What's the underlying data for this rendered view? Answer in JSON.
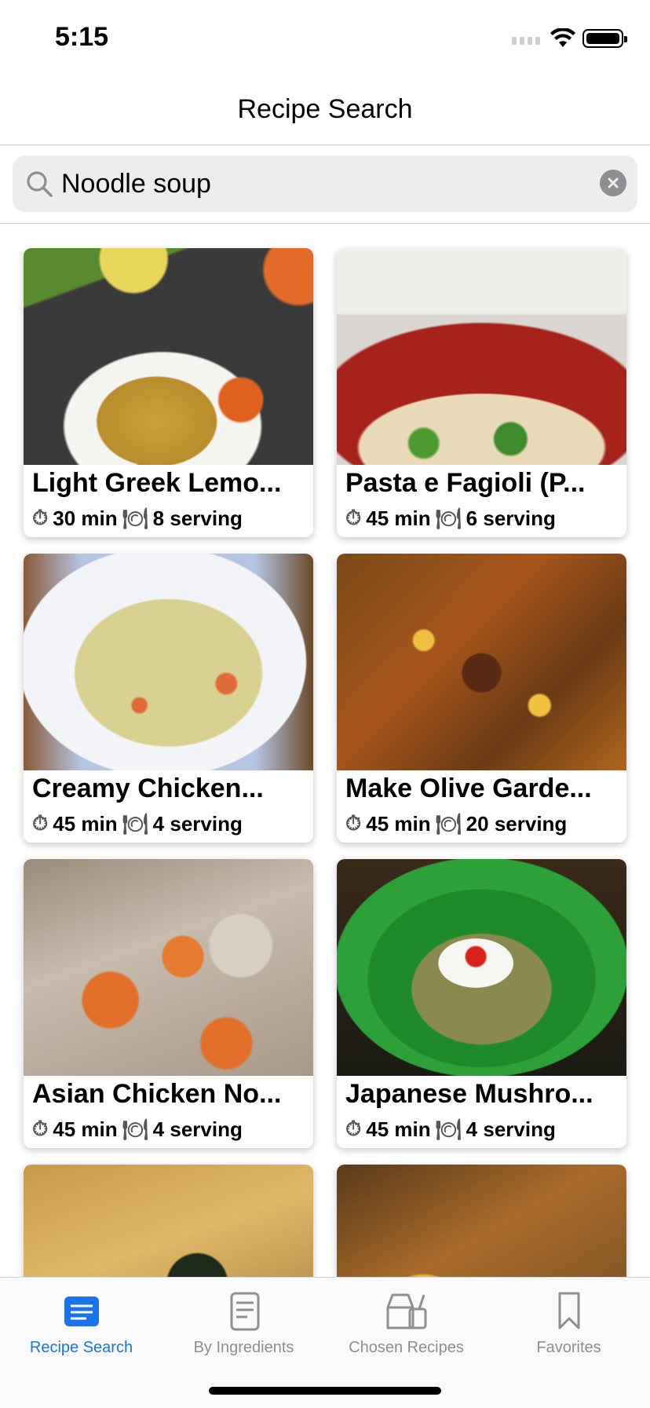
{
  "status": {
    "time": "5:15"
  },
  "nav": {
    "title": "Recipe Search"
  },
  "search": {
    "value": "Noodle soup",
    "placeholder": "Search"
  },
  "recipes": [
    {
      "title": "Light Greek Lemo...",
      "time": "30 min",
      "servings": "8 serving"
    },
    {
      "title": "Pasta e Fagioli (P...",
      "time": "45 min",
      "servings": "6 serving"
    },
    {
      "title": "Creamy Chicken...",
      "time": "45 min",
      "servings": "4 serving"
    },
    {
      "title": "Make Olive Garde...",
      "time": "45 min",
      "servings": "20 serving"
    },
    {
      "title": "Asian Chicken No...",
      "time": "45 min",
      "servings": "4 serving"
    },
    {
      "title": "Japanese Mushro...",
      "time": "45 min",
      "servings": "4 serving"
    },
    {
      "title": "",
      "time": "",
      "servings": ""
    },
    {
      "title": "",
      "time": "",
      "servings": ""
    }
  ],
  "tabs": [
    {
      "label": "Recipe Search",
      "icon": "recipe-search-icon",
      "active": true
    },
    {
      "label": "By Ingredients",
      "icon": "ingredients-list-icon",
      "active": false
    },
    {
      "label": "Chosen Recipes",
      "icon": "chosen-recipes-icon",
      "active": false
    },
    {
      "label": "Favorites",
      "icon": "bookmark-icon",
      "active": false
    }
  ],
  "colors": {
    "accent": "#1a73e8",
    "inactive": "#8e8e93"
  }
}
